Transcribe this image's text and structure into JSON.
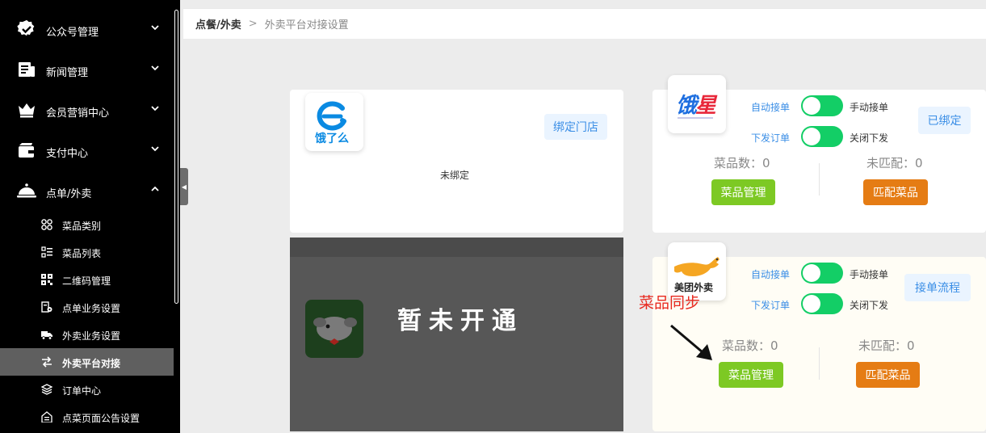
{
  "sidebar": {
    "groups": [
      {
        "label": "公众号管理",
        "icon": "badge-check-icon"
      },
      {
        "label": "新闻管理",
        "icon": "news-icon"
      },
      {
        "label": "会员营销中心",
        "icon": "crown-icon"
      },
      {
        "label": "支付中心",
        "icon": "wallet-icon"
      },
      {
        "label": "点单/外卖",
        "icon": "cloche-icon"
      }
    ],
    "items": [
      {
        "label": "菜品类别",
        "icon": "grid-icon"
      },
      {
        "label": "菜品列表",
        "icon": "list-icon"
      },
      {
        "label": "二维码管理",
        "icon": "qrcode-icon"
      },
      {
        "label": "点单业务设置",
        "icon": "order-settings-icon"
      },
      {
        "label": "外卖业务设置",
        "icon": "delivery-truck-icon"
      },
      {
        "label": "外卖平台对接",
        "icon": "swap-icon"
      },
      {
        "label": "订单中心",
        "icon": "layers-icon"
      },
      {
        "label": "点菜页面公告设置",
        "icon": "home-notice-icon"
      }
    ]
  },
  "breadcrumb": {
    "parent": "点餐/外卖",
    "separator": ">",
    "current": "外卖平台对接设置"
  },
  "eleme": {
    "logo_text": "饿了么",
    "bind_button": "绑定门店",
    "status": "未绑定"
  },
  "jd": {
    "status": "暂未开通"
  },
  "ele_star": {
    "logo_text": "饿了么星选",
    "auto_accept": "自动接单",
    "manual_accept": "手动接单",
    "dispatch": "下发订单",
    "close_dispatch": "关闭下发",
    "bound_button": "已绑定",
    "dish_count": "菜品数：0",
    "unmatched": "未匹配：0",
    "manage_button": "菜品管理",
    "match_button": "匹配菜品"
  },
  "meituan": {
    "logo_text": "美团外卖",
    "auto_accept": "自动接单",
    "manual_accept": "手动接单",
    "dispatch": "下发订单",
    "close_dispatch": "关闭下发",
    "flow_button": "接单流程",
    "dish_count": "菜品数：0",
    "unmatched": "未匹配：0",
    "manage_button": "菜品管理",
    "match_button": "匹配菜品"
  },
  "annotation": {
    "text": "菜品同步",
    "color": "#e8281e"
  },
  "colors": {
    "accent": "#3a8ee6",
    "toggle_on": "#13ce66",
    "green": "#7dc924",
    "orange": "#e57c14"
  }
}
